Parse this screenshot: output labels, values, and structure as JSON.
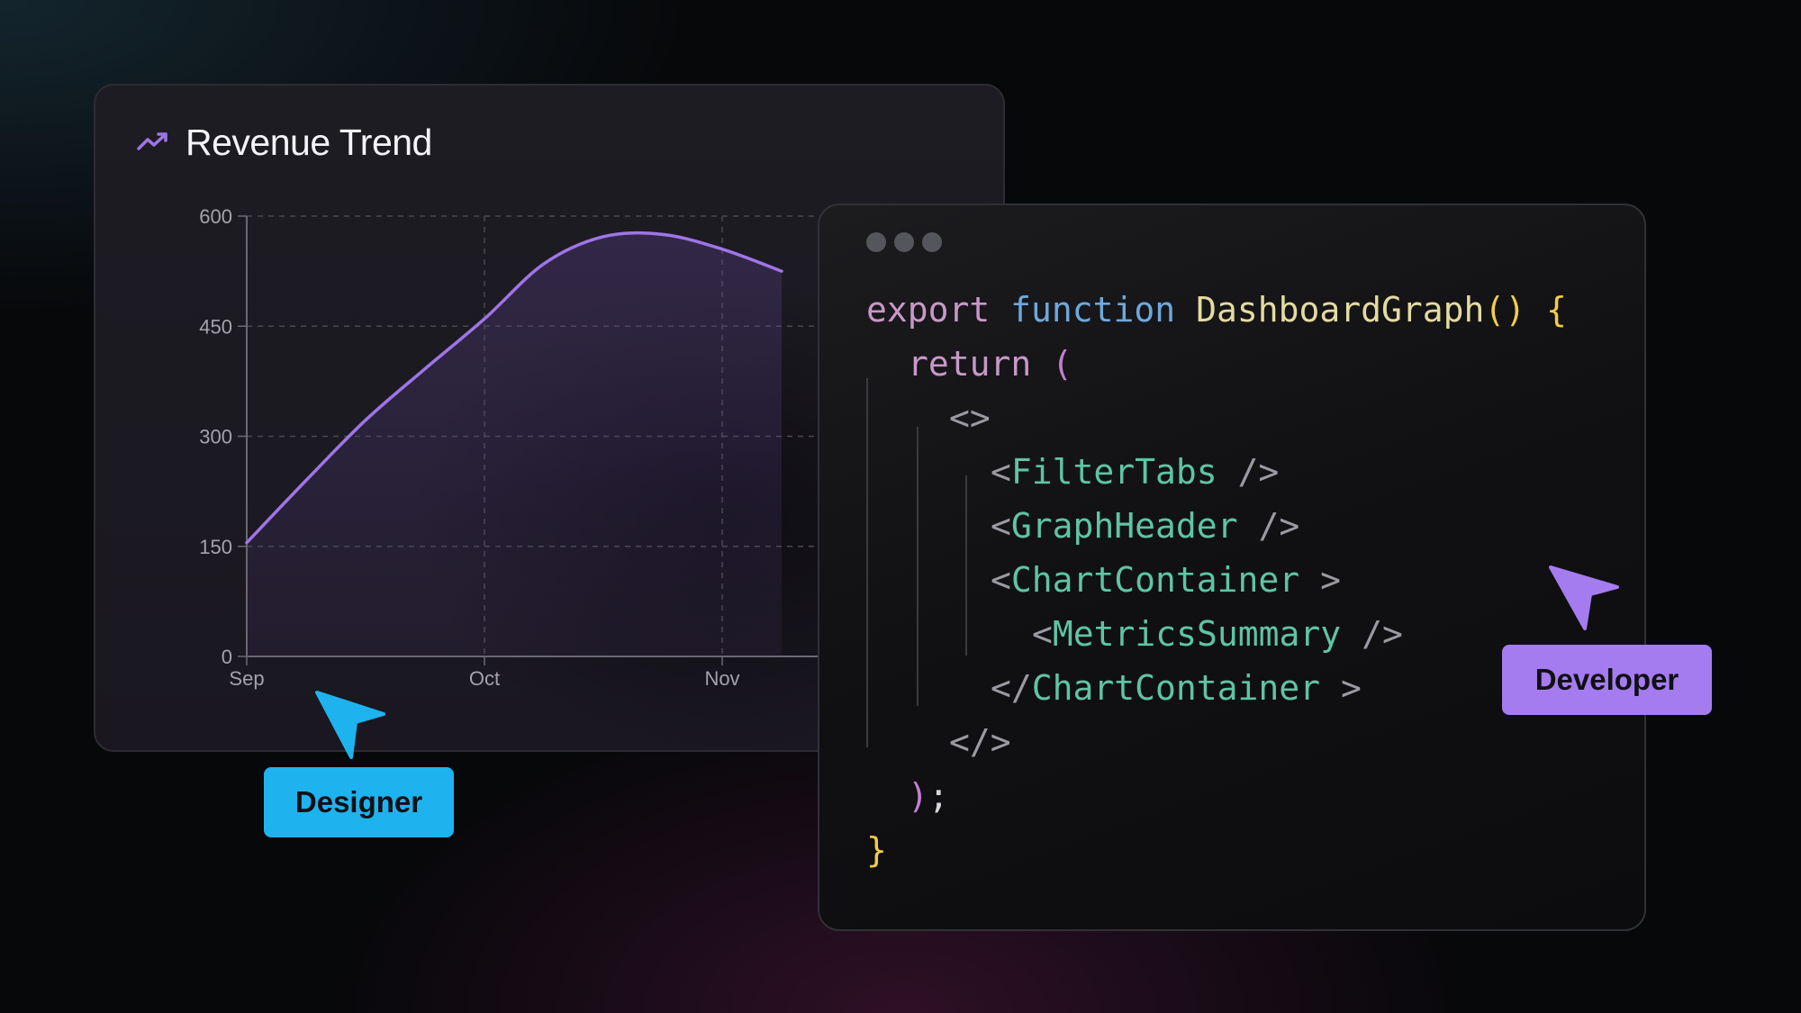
{
  "chart_card": {
    "title": "Revenue Trend",
    "title_icon": "trending-up-icon",
    "accent": "#9f75e6"
  },
  "chart_data": {
    "type": "area",
    "title": "Revenue Trend",
    "xlabel": "",
    "ylabel": "",
    "x_ticks": [
      "Sep",
      "Oct",
      "Nov"
    ],
    "y_ticks": [
      0,
      150,
      300,
      450,
      600
    ],
    "ylim": [
      0,
      600
    ],
    "grid": true,
    "series": [
      {
        "x": [
          0,
          0.25,
          0.5,
          0.75,
          1.0,
          1.25,
          1.5,
          1.75,
          2.0,
          2.25
        ],
        "y": [
          155,
          240,
          322,
          392,
          460,
          535,
          572,
          575,
          555,
          525
        ]
      }
    ]
  },
  "code_card": {
    "lines": [
      {
        "indent": 0,
        "tokens": [
          [
            "export ",
            "kw-export"
          ],
          [
            "function ",
            "kw-func"
          ],
          [
            "DashboardGraph",
            "fn-name"
          ],
          [
            "() {",
            "paren-y"
          ]
        ]
      },
      {
        "indent": 1,
        "tokens": [
          [
            "return ",
            "ret"
          ],
          [
            "(",
            "paren-p"
          ]
        ]
      },
      {
        "indent": 2,
        "tokens": [
          [
            "<>",
            "brkt"
          ]
        ]
      },
      {
        "indent": 3,
        "tokens": [
          [
            "<",
            "brkt"
          ],
          [
            "FilterTabs",
            "comp"
          ],
          [
            " />",
            "brkt"
          ]
        ]
      },
      {
        "indent": 3,
        "tokens": [
          [
            "<",
            "brkt"
          ],
          [
            "GraphHeader",
            "comp"
          ],
          [
            " />",
            "brkt"
          ]
        ]
      },
      {
        "indent": 3,
        "tokens": [
          [
            "<",
            "brkt"
          ],
          [
            "ChartContainer",
            "comp"
          ],
          [
            " >",
            "brkt"
          ]
        ]
      },
      {
        "indent": 4,
        "tokens": [
          [
            "<",
            "brkt"
          ],
          [
            "MetricsSummary",
            "comp"
          ],
          [
            " />",
            "brkt"
          ]
        ]
      },
      {
        "indent": 3,
        "tokens": [
          [
            "</",
            "brkt"
          ],
          [
            "ChartContainer",
            "comp"
          ],
          [
            " >",
            "brkt"
          ]
        ]
      },
      {
        "indent": 2,
        "tokens": [
          [
            "</>",
            "brkt"
          ]
        ]
      },
      {
        "indent": 1,
        "tokens": [
          [
            ")",
            "paren-p"
          ],
          [
            ";",
            "punct"
          ]
        ]
      },
      {
        "indent": 0,
        "tokens": [
          [
            "}",
            "paren-y"
          ]
        ]
      }
    ]
  },
  "designer": {
    "label": "Designer",
    "color": "#1eb3ee"
  },
  "developer": {
    "label": "Developer",
    "color": "#a57cf0"
  }
}
